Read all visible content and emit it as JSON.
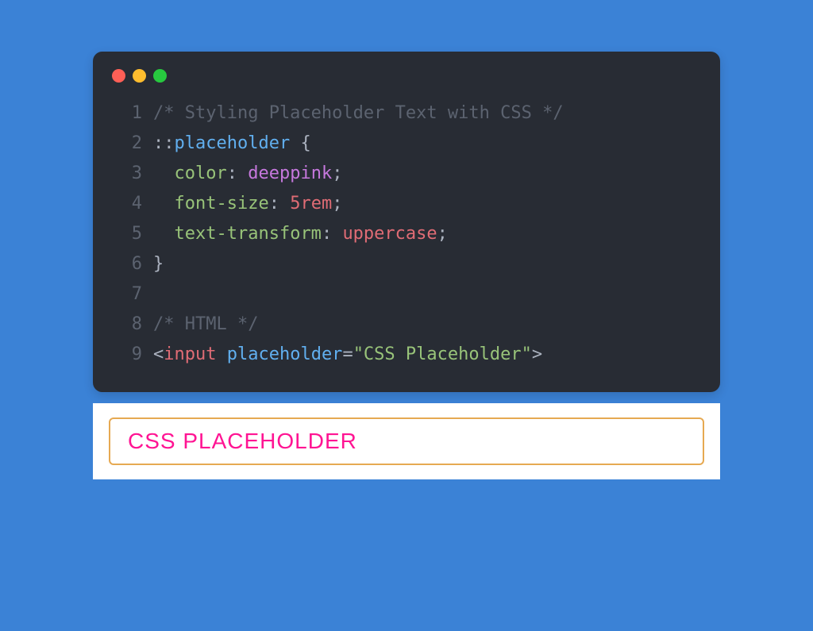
{
  "window": {
    "traffic_lights": [
      "close",
      "minimize",
      "zoom"
    ]
  },
  "code": {
    "lines": [
      {
        "num": "1",
        "tokens": [
          {
            "cls": "c-comment",
            "text": "/* Styling Placeholder Text with CSS */"
          }
        ]
      },
      {
        "num": "2",
        "tokens": [
          {
            "cls": "c-punc",
            "text": "::"
          },
          {
            "cls": "c-selector",
            "text": "placeholder "
          },
          {
            "cls": "c-punc",
            "text": "{"
          }
        ]
      },
      {
        "num": "3",
        "tokens": [
          {
            "cls": "c-punc",
            "text": "  "
          },
          {
            "cls": "c-prop",
            "text": "color"
          },
          {
            "cls": "c-colon",
            "text": ": "
          },
          {
            "cls": "c-val1",
            "text": "deeppink"
          },
          {
            "cls": "c-punc",
            "text": ";"
          }
        ]
      },
      {
        "num": "4",
        "tokens": [
          {
            "cls": "c-punc",
            "text": "  "
          },
          {
            "cls": "c-prop",
            "text": "font-size"
          },
          {
            "cls": "c-colon",
            "text": ": "
          },
          {
            "cls": "c-val2",
            "text": "5rem"
          },
          {
            "cls": "c-punc",
            "text": ";"
          }
        ]
      },
      {
        "num": "5",
        "tokens": [
          {
            "cls": "c-punc",
            "text": "  "
          },
          {
            "cls": "c-prop",
            "text": "text-transform"
          },
          {
            "cls": "c-colon",
            "text": ": "
          },
          {
            "cls": "c-val3",
            "text": "uppercase"
          },
          {
            "cls": "c-punc",
            "text": ";"
          }
        ]
      },
      {
        "num": "6",
        "tokens": [
          {
            "cls": "c-punc",
            "text": "}"
          }
        ]
      },
      {
        "num": "7",
        "tokens": []
      },
      {
        "num": "8",
        "tokens": [
          {
            "cls": "c-comment",
            "text": "/* HTML */"
          }
        ]
      },
      {
        "num": "9",
        "tokens": [
          {
            "cls": "c-bracket",
            "text": "<"
          },
          {
            "cls": "c-tag",
            "text": "input "
          },
          {
            "cls": "c-attr",
            "text": "placeholder"
          },
          {
            "cls": "c-eq",
            "text": "="
          },
          {
            "cls": "c-string",
            "text": "\"CSS Placeholder\""
          },
          {
            "cls": "c-bracket",
            "text": ">"
          }
        ]
      }
    ]
  },
  "demo": {
    "placeholder": "CSS Placeholder"
  }
}
